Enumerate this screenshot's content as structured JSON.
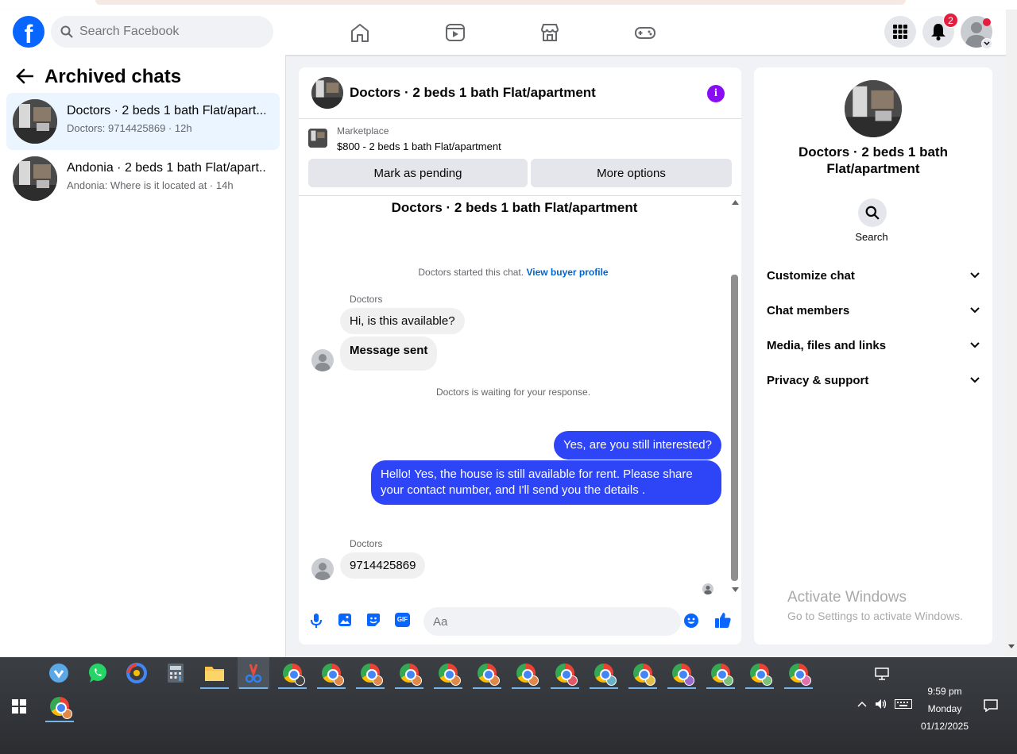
{
  "header": {
    "logo_letter": "f",
    "search_placeholder": "Search Facebook",
    "notification_count": "2"
  },
  "left_panel": {
    "title": "Archived chats",
    "chats": [
      {
        "name": "Doctors · 2 beds 1 bath Flat/apart...",
        "preview": "Doctors: 9714425869 · 12h"
      },
      {
        "name": "Andonia · 2 beds 1 bath Flat/apart...",
        "preview": "Andonia: Where is it located at · 14h"
      }
    ]
  },
  "conversation": {
    "title": "Doctors · 2 beds 1 bath Flat/apartment",
    "marketplace_label": "Marketplace",
    "listing": "$800 - 2 beds 1 bath Flat/apartment",
    "mark_pending": "Mark as pending",
    "more_options": "More options",
    "intro_title": "Doctors · 2 beds 1 bath Flat/apartment",
    "started_text": "Doctors started this chat.",
    "buyer_profile_link": "View buyer profile",
    "sender_name": "Doctors",
    "msg1": "Hi, is this available?",
    "msg2": "Message sent",
    "waiting_text": "Doctors is waiting for your response.",
    "out1": "Yes, are you still interested?",
    "out2": "Hello! Yes, the house is still available for rent. Please share your contact number, and I'll send you the details .",
    "sender_name2": "Doctors",
    "msg3": "9714425869",
    "compose_placeholder": "Aa",
    "gif_label": "GIF"
  },
  "right_panel": {
    "name": "Doctors · 2 beds 1 bath Flat/apartment",
    "search_label": "Search",
    "sections": [
      "Customize chat",
      "Chat members",
      "Media, files and links",
      "Privacy & support"
    ]
  },
  "watermark": {
    "line1": "Activate Windows",
    "line2": "Go to Settings to activate Windows."
  },
  "taskbar": {
    "time": "9:59 pm",
    "day": "Monday",
    "date": "01/12/2025"
  },
  "colors": {
    "brand": "#0866ff",
    "outgoing_bubble": "#2d44f7",
    "info_purple": "#8a0cf4",
    "badge_red": "#e41e3f"
  }
}
